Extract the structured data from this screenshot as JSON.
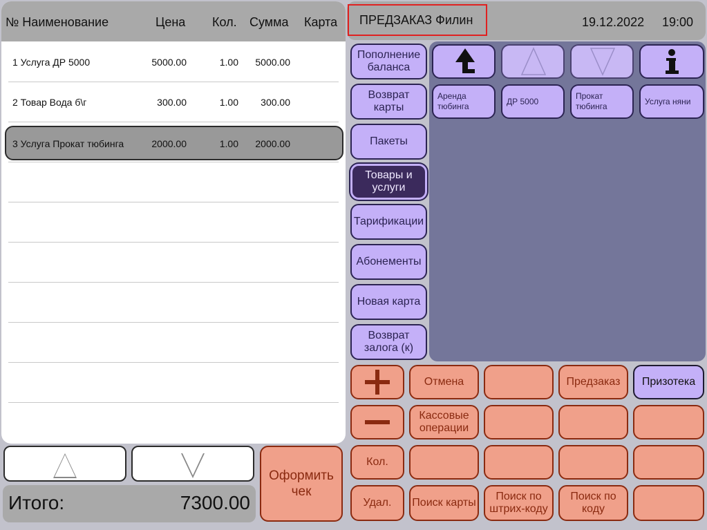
{
  "receipt": {
    "columns": {
      "num_name": "№ Наименование",
      "price": "Цена",
      "qty": "Кол.",
      "sum": "Сумма",
      "card": "Карта"
    },
    "rows": [
      {
        "name": "1 Услуга ДР 5000",
        "price": "5000.00",
        "qty": "1.00",
        "sum": "5000.00",
        "card": ""
      },
      {
        "name": "2 Товар Вода б\\г",
        "price": "300.00",
        "qty": "1.00",
        "sum": "300.00",
        "card": ""
      },
      {
        "name": "3 Услуга Прокат тюбинга",
        "price": "2000.00",
        "qty": "1.00",
        "sum": "2000.00",
        "card": "",
        "selected": true
      }
    ]
  },
  "totals": {
    "label": "Итого:",
    "value": "7300.00"
  },
  "checkout_label": "Оформить чек",
  "header": {
    "mode": "ПРЕДЗАКАЗ Филин",
    "date": "19.12.2022",
    "time": "19:00"
  },
  "categories": [
    {
      "label": "Пополнение баланса"
    },
    {
      "label": "Возврат карты"
    },
    {
      "label": "Пакеты"
    },
    {
      "label": "Товары и услуги",
      "active": true
    },
    {
      "label": "Тарификации"
    },
    {
      "label": "Абонементы"
    },
    {
      "label": "Новая карта"
    },
    {
      "label": "Возврат залога (к)"
    }
  ],
  "nav_icons": [
    "up-level-arrow-icon",
    "up-triangle-icon",
    "down-triangle-icon",
    "info-icon"
  ],
  "items": [
    {
      "label": "Аренда тюбинга"
    },
    {
      "label": "ДР 5000"
    },
    {
      "label": "Прокат тюбинга"
    },
    {
      "label": "Услуга няни"
    }
  ],
  "keypad": {
    "plus_icon": "plus-icon",
    "minus_icon": "minus-icon",
    "qty": "Кол.",
    "delete": "Удал.",
    "cancel": "Отмена",
    "cash_ops": "Кассовые операции",
    "search_card": "Поиск карты",
    "search_barcode": "Поиск по штрих-коду",
    "search_code": "Поиск по коду",
    "preorder": "Предзаказ",
    "prize_library": "Призотека"
  },
  "colors": {
    "panel_gray": "#a9a9a9",
    "background": "#c2c2cc",
    "salmon": "#f0a08a",
    "salmon_text": "#8a2a10",
    "lavender": "#c4b0f8",
    "active_purple": "#3b2a5c",
    "items_panel": "#74769a",
    "mode_border": "#e02020"
  }
}
